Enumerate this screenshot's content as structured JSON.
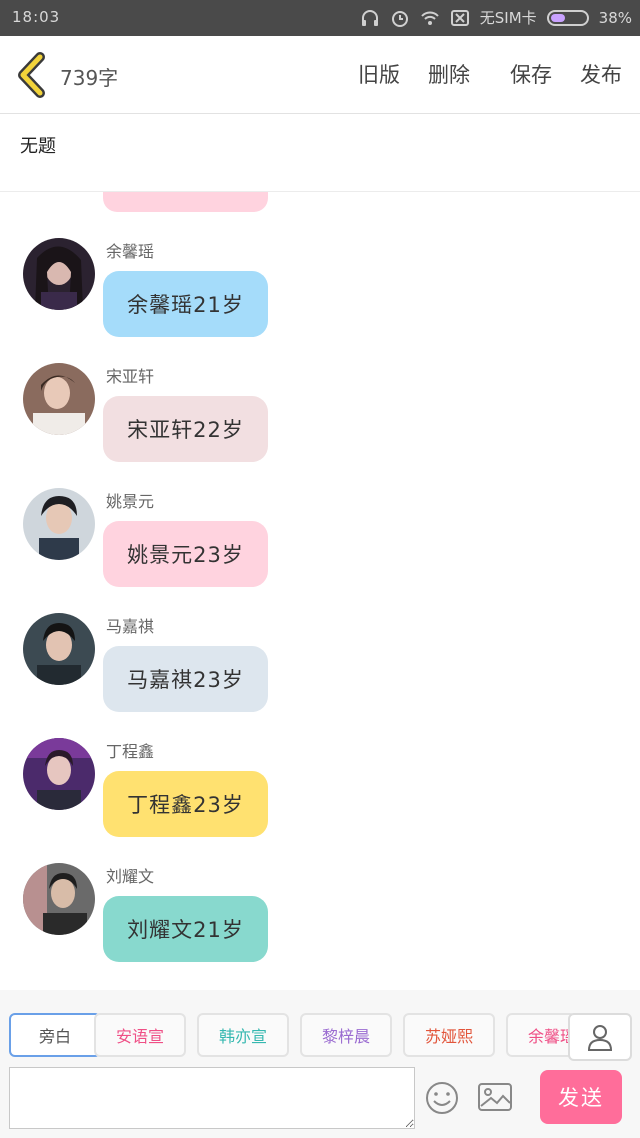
{
  "statusbar": {
    "time": "18:03",
    "carrier": "无SIM卡",
    "battery": "38%"
  },
  "header": {
    "word_count": "739字",
    "actions": [
      "旧版",
      "删除",
      "保存",
      "发布"
    ]
  },
  "title": "无题",
  "messages": [
    {
      "name": "余馨瑶",
      "text": "余馨瑶21岁",
      "bubble_color": "#a5dcfa",
      "avatar_color": "#2b2230"
    },
    {
      "name": "宋亚轩",
      "text": "宋亚轩22岁",
      "bubble_color": "#f2dfe1",
      "avatar_color": "#8a6b5e"
    },
    {
      "name": "姚景元",
      "text": "姚景元23岁",
      "bubble_color": "#ffd3df",
      "avatar_color": "#2e3a4a"
    },
    {
      "name": "马嘉祺",
      "text": "马嘉祺23岁",
      "bubble_color": "#dde6ee",
      "avatar_color": "#3c4a52"
    },
    {
      "name": "丁程鑫",
      "text": "丁程鑫23岁",
      "bubble_color": "#ffe170",
      "avatar_color": "#4b2a6b"
    },
    {
      "name": "刘耀文",
      "text": "刘耀文21岁",
      "bubble_color": "#88d9ce",
      "avatar_color": "#5a5a5a"
    }
  ],
  "roles": [
    {
      "label": "旁白",
      "color": "#555555"
    },
    {
      "label": "安语宣",
      "color": "#ef4f86"
    },
    {
      "label": "韩亦宣",
      "color": "#36b8b0"
    },
    {
      "label": "黎梓晨",
      "color": "#9a6bd1"
    },
    {
      "label": "苏娅熙",
      "color": "#e2553b"
    },
    {
      "label": "余馨瑶",
      "color": "#ef4f86"
    }
  ],
  "input": {
    "send_label": "发送"
  },
  "icons": {
    "back": "chevron-left-icon",
    "emoji": "smiley-icon",
    "image": "image-icon",
    "profile": "person-icon"
  },
  "colors": {
    "accent": "#ff6d9a",
    "back_arrow": "#f2d33a"
  }
}
